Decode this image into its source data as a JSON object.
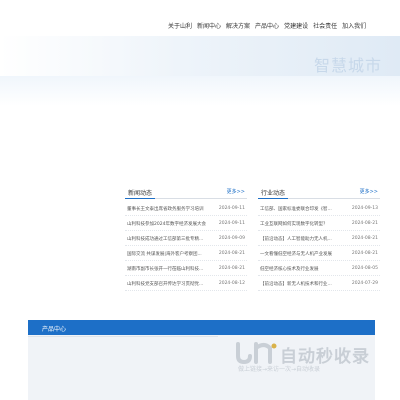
{
  "nav": {
    "items": [
      "关于山利",
      "新闻中心",
      "解决方案",
      "产品中心",
      "党建建设",
      "社会责任",
      "加入我们"
    ]
  },
  "banner": {
    "slogan": "智慧城市"
  },
  "news": {
    "title": "新闻动态",
    "more": "更多>>",
    "items": [
      {
        "title": "董事长王文泰出席省政务服务学习培训",
        "date": "2024-09-11"
      },
      {
        "title": "山利科技参加2024年数字经济发展大会",
        "date": "2024-09-11"
      },
      {
        "title": "山利科技成功通过工信部第三批专精...",
        "date": "2024-09-09"
      },
      {
        "title": "国际交流 共谋发展|海外客户考察团...",
        "date": "2024-08-21"
      },
      {
        "title": "湖南市副市长张开一行莅临山利科技...",
        "date": "2024-08-21"
      },
      {
        "title": "山利科技党支部召开传达学习贯彻党...",
        "date": "2024-08-12"
      }
    ]
  },
  "industry": {
    "title": "行业动态",
    "more": "更多>>",
    "items": [
      {
        "title": "工信部、国家标准委联合印发《智...",
        "date": "2024-09-13"
      },
      {
        "title": "工业互联网如何实现数字化转型？",
        "date": "2024-08-21"
      },
      {
        "title": "【前沿动态】人工智能助力无人机...",
        "date": "2024-08-21"
      },
      {
        "title": "一文看懂低空经济与无人机产业发展",
        "date": "2024-08-21"
      },
      {
        "title": "低空经济核心技术及行业发展",
        "date": "2024-08-05"
      },
      {
        "title": "【前沿动态】新无人机技术和行业...",
        "date": "2024-07-29"
      }
    ]
  },
  "products": {
    "title": "产品中心"
  },
  "watermark": {
    "text": "自动秒收录",
    "sub": "做上链接→来访一次→自动收录"
  },
  "colors": {
    "accent": "#1d6fc7",
    "banner_text": "#c7d8ea"
  }
}
